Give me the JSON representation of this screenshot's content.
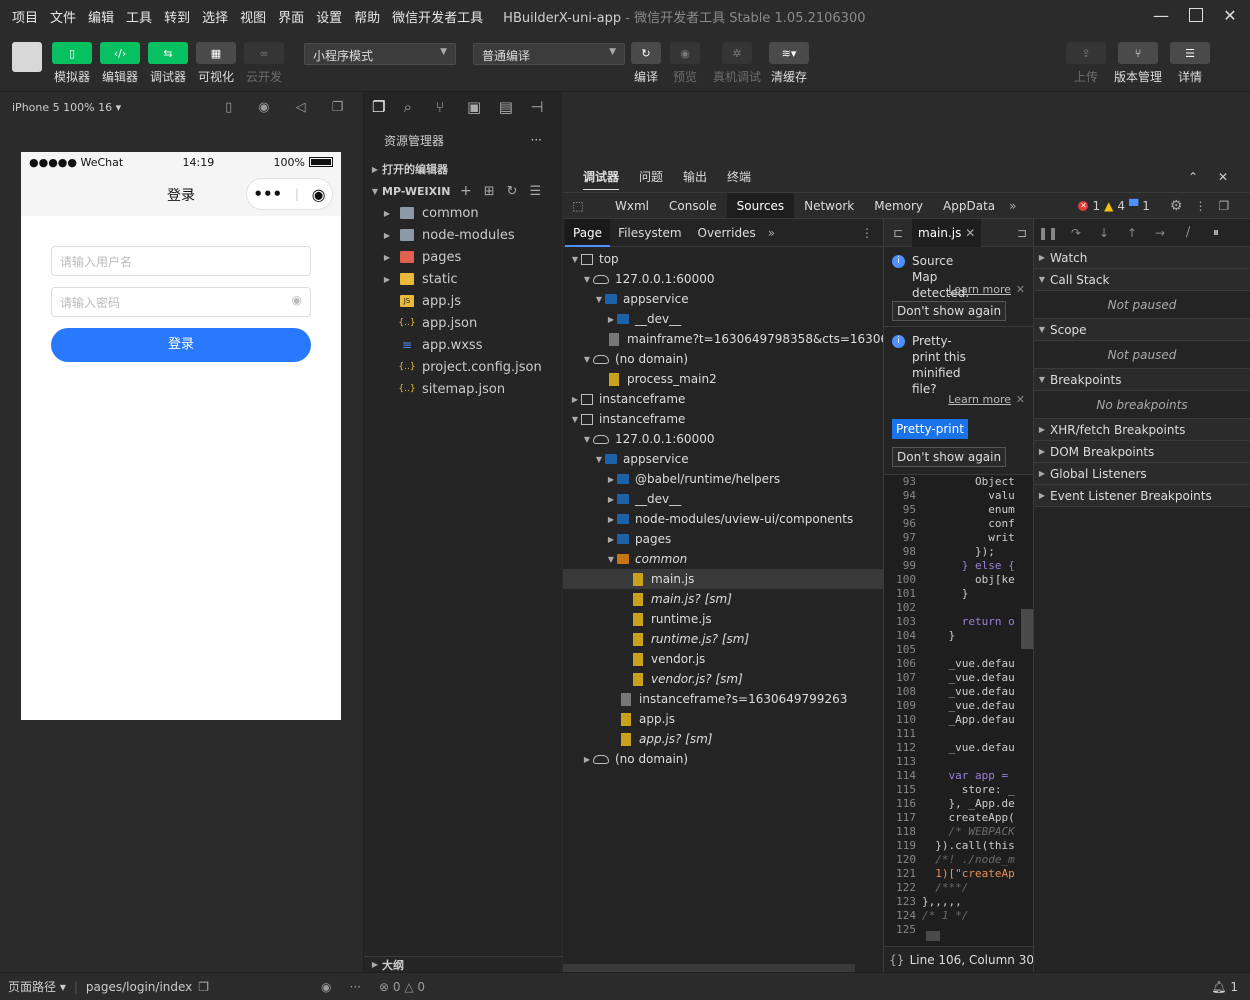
{
  "menu": [
    "项目",
    "文件",
    "编辑",
    "工具",
    "转到",
    "选择",
    "视图",
    "界面",
    "设置",
    "帮助",
    "微信开发者工具"
  ],
  "window": {
    "title": "HBuilderX-uni-app",
    "subtitle": " - 微信开发者工具 Stable 1.05.2106300"
  },
  "toolbar": {
    "left_buttons": [
      {
        "label": "模拟器",
        "icon": "phone-icon"
      },
      {
        "label": "编辑器",
        "icon": "code-icon"
      },
      {
        "label": "调试器",
        "icon": "debug-icon"
      },
      {
        "label": "可视化",
        "icon": "layout-icon"
      },
      {
        "label": "云开发",
        "icon": "cloud-icon"
      }
    ],
    "mode_select": "小程序模式",
    "compile_select": "普通编译",
    "mid_buttons": [
      {
        "label": "编译",
        "icon": "refresh-icon"
      },
      {
        "label": "预览",
        "icon": "eye-icon"
      },
      {
        "label": "真机调试",
        "icon": "bug-icon"
      },
      {
        "label": "清缓存",
        "icon": "layers-icon"
      }
    ],
    "right_buttons": [
      {
        "label": "上传",
        "icon": "upload-icon"
      },
      {
        "label": "版本管理",
        "icon": "branch-icon"
      },
      {
        "label": "详情",
        "icon": "menu-icon"
      }
    ]
  },
  "simulator": {
    "device": "iPhone 5 100% 16",
    "status_left": "●●●●● WeChat",
    "status_time": "14:19",
    "status_battery": "100%",
    "nav_title": "登录",
    "username_placeholder": "请输入用户名",
    "password_placeholder": "请输入密码",
    "login_button": "登录"
  },
  "bottom": {
    "page_path_label": "页面路径",
    "page_path": "pages/login/index",
    "errors": "0",
    "warnings": "0",
    "notifications": "1"
  },
  "explorer": {
    "title": "资源管理器",
    "open_editors": "打开的编辑器",
    "project": "MP-WEIXIN",
    "outline": "大纲",
    "items": [
      {
        "name": "common",
        "type": "folder"
      },
      {
        "name": "node-modules",
        "type": "folder"
      },
      {
        "name": "pages",
        "type": "folder-red"
      },
      {
        "name": "static",
        "type": "folder-yellow"
      },
      {
        "name": "app.js",
        "type": "js"
      },
      {
        "name": "app.json",
        "type": "json"
      },
      {
        "name": "app.wxss",
        "type": "css"
      },
      {
        "name": "project.config.json",
        "type": "json"
      },
      {
        "name": "sitemap.json",
        "type": "json"
      }
    ]
  },
  "devtools": {
    "top_tabs": [
      "调试器",
      "问题",
      "输出",
      "终端"
    ],
    "tabs": [
      "Wxml",
      "Console",
      "Sources",
      "Network",
      "Memory",
      "AppData"
    ],
    "active_tab": "Sources",
    "errors": "1",
    "warnings": "4",
    "infos": "1",
    "nav_tabs": [
      "Page",
      "Filesystem",
      "Overrides"
    ],
    "tree": [
      {
        "d": 0,
        "t": "frame",
        "open": true,
        "name": "top"
      },
      {
        "d": 1,
        "t": "cloud",
        "open": true,
        "name": "127.0.0.1:60000"
      },
      {
        "d": 2,
        "t": "folder",
        "open": true,
        "name": "appservice"
      },
      {
        "d": 3,
        "t": "folder",
        "open": false,
        "name": "__dev__"
      },
      {
        "d": 3,
        "t": "gfile",
        "name": "mainframe?t=1630649798358&cts=16306497"
      },
      {
        "d": 1,
        "t": "cloud",
        "open": true,
        "name": "(no domain)"
      },
      {
        "d": 2,
        "t": "file",
        "name": "process_main2"
      },
      {
        "d": 0,
        "t": "frame",
        "open": false,
        "name": "instanceframe"
      },
      {
        "d": 0,
        "t": "frame",
        "open": true,
        "name": "instanceframe"
      },
      {
        "d": 1,
        "t": "cloud",
        "open": true,
        "name": "127.0.0.1:60000"
      },
      {
        "d": 2,
        "t": "folder",
        "open": true,
        "name": "appservice"
      },
      {
        "d": 3,
        "t": "folder",
        "open": false,
        "name": "@babel/runtime/helpers"
      },
      {
        "d": 3,
        "t": "folder",
        "open": false,
        "name": "__dev__"
      },
      {
        "d": 3,
        "t": "folder",
        "open": false,
        "name": "node-modules/uview-ui/components"
      },
      {
        "d": 3,
        "t": "folder",
        "open": false,
        "name": "pages"
      },
      {
        "d": 3,
        "t": "ofolder",
        "open": true,
        "name": "common",
        "italic": true
      },
      {
        "d": 4,
        "t": "file",
        "name": "main.js",
        "hl": true
      },
      {
        "d": 4,
        "t": "file",
        "name": "main.js? [sm]",
        "italic": true
      },
      {
        "d": 4,
        "t": "file",
        "name": "runtime.js"
      },
      {
        "d": 4,
        "t": "file",
        "name": "runtime.js? [sm]",
        "italic": true
      },
      {
        "d": 4,
        "t": "file",
        "name": "vendor.js"
      },
      {
        "d": 4,
        "t": "file",
        "name": "vendor.js? [sm]",
        "italic": true
      },
      {
        "d": 3,
        "t": "gfile",
        "name": "instanceframe?s=1630649799263"
      },
      {
        "d": 3,
        "t": "file",
        "name": "app.js"
      },
      {
        "d": 3,
        "t": "file",
        "name": "app.js? [sm]",
        "italic": true
      },
      {
        "d": 1,
        "t": "cloud",
        "open": false,
        "name": "(no domain)"
      }
    ],
    "editor_tab": "main.js",
    "info1": "Source Map detected.",
    "info2": "Pretty-print this minified file?",
    "learn_more": "Learn more",
    "dont_show": "Don't show again",
    "pretty_print": "Pretty-print",
    "status": "Line 106, Column 30",
    "code": [
      {
        "n": "93",
        "c": "        Object"
      },
      {
        "n": "94",
        "c": "          valu"
      },
      {
        "n": "95",
        "c": "          enum"
      },
      {
        "n": "96",
        "c": "          conf"
      },
      {
        "n": "97",
        "c": "          writ"
      },
      {
        "n": "98",
        "c": "        });"
      },
      {
        "n": "99",
        "c": "      } else {"
      },
      {
        "n": "100",
        "c": "        obj[ke"
      },
      {
        "n": "101",
        "c": "      }"
      },
      {
        "n": "102",
        "c": ""
      },
      {
        "n": "103",
        "c": "      return o"
      },
      {
        "n": "104",
        "c": "    }"
      },
      {
        "n": "105",
        "c": ""
      },
      {
        "n": "106",
        "c": "    _vue.defau"
      },
      {
        "n": "107",
        "c": "    _vue.defau"
      },
      {
        "n": "108",
        "c": "    _vue.defau"
      },
      {
        "n": "109",
        "c": "    _vue.defau"
      },
      {
        "n": "110",
        "c": "    _App.defau"
      },
      {
        "n": "111",
        "c": ""
      },
      {
        "n": "112",
        "c": "    _vue.defau"
      },
      {
        "n": "113",
        "c": ""
      },
      {
        "n": "114",
        "c": "    var app = "
      },
      {
        "n": "115",
        "c": "      store: _"
      },
      {
        "n": "116",
        "c": "    }, _App.de"
      },
      {
        "n": "117",
        "c": "    createApp("
      },
      {
        "n": "118",
        "c": "    /* WEBPACK"
      },
      {
        "n": "119",
        "c": "  }).call(this"
      },
      {
        "n": "120",
        "c": "  /*! ./node_m"
      },
      {
        "n": "121",
        "c": "  1)[\"createAp"
      },
      {
        "n": "122",
        "c": "  /***/"
      },
      {
        "n": "123",
        "c": "},,,,,"
      },
      {
        "n": "124",
        "c": "/* 1 */"
      },
      {
        "n": "125",
        "c": ""
      }
    ],
    "sections": [
      {
        "title": "Watch",
        "open": false
      },
      {
        "title": "Call Stack",
        "open": true,
        "body": "Not paused"
      },
      {
        "title": "Scope",
        "open": true,
        "body": "Not paused"
      },
      {
        "title": "Breakpoints",
        "open": true,
        "body": "No breakpoints"
      },
      {
        "title": "XHR/fetch Breakpoints",
        "open": false
      },
      {
        "title": "DOM Breakpoints",
        "open": false
      },
      {
        "title": "Global Listeners",
        "open": false
      },
      {
        "title": "Event Listener Breakpoints",
        "open": false
      }
    ]
  }
}
